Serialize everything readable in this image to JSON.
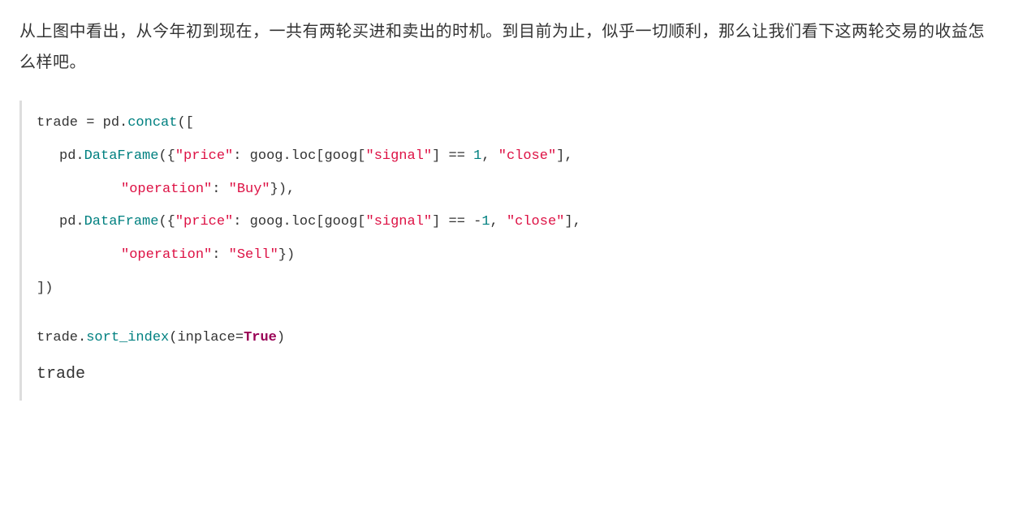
{
  "prose": "从上图中看出，从今年初到现在，一共有两轮买进和卖出的时机。到目前为止，似乎一切顺利，那么让我们看下这两轮交易的收益怎么样吧。",
  "code": {
    "line1": {
      "s1": "trade = pd.",
      "s2": "concat",
      "s3": "(["
    },
    "line2": {
      "s1": "pd.",
      "s2": "DataFrame",
      "s3": "({",
      "s4": "\"price\"",
      "s5": ": goog.loc[goog[",
      "s6": "\"signal\"",
      "s7": "] == ",
      "s8": "1",
      "s9": ", ",
      "s10": "\"close\"",
      "s11": "],"
    },
    "line3": {
      "s1": "\"operation\"",
      "s2": ": ",
      "s3": "\"Buy\"",
      "s4": "}),"
    },
    "line4": {
      "s1": "pd.",
      "s2": "DataFrame",
      "s3": "({",
      "s4": "\"price\"",
      "s5": ": goog.loc[goog[",
      "s6": "\"signal\"",
      "s7": "] == -",
      "s8": "1",
      "s9": ", ",
      "s10": "\"close\"",
      "s11": "],"
    },
    "line5": {
      "s1": "\"operation\"",
      "s2": ": ",
      "s3": "\"Sell\"",
      "s4": "})"
    },
    "line6": {
      "s1": "])"
    },
    "line7": {
      "s1": "trade.",
      "s2": "sort_index",
      "s3": "(inplace=",
      "s4": "True",
      "s5": ")"
    },
    "line8": {
      "s1": "trade"
    }
  }
}
